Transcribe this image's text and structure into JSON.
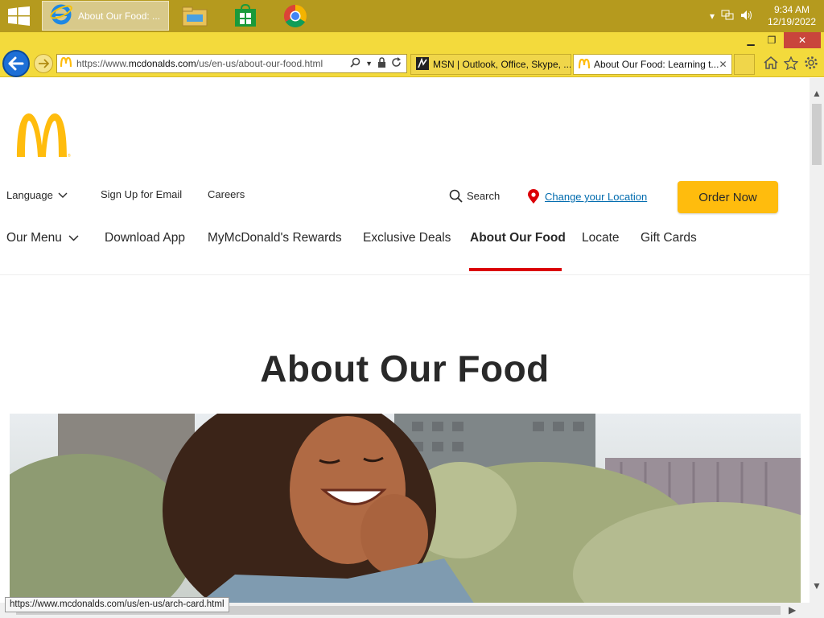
{
  "taskbar": {
    "ie_task_label": "About Our Food: ...",
    "clock_time": "9:34 AM",
    "clock_date": "12/19/2022"
  },
  "browser": {
    "url_prefix": "https://www.",
    "url_domain": "mcdonalds.com",
    "url_path": "/us/en-us/about-our-food.html",
    "tabs": [
      {
        "label": "MSN | Outlook, Office, Skype, ..."
      },
      {
        "label": "About Our Food: Learning t..."
      }
    ],
    "status_url": "https://www.mcdonalds.com/us/en-us/arch-card.html"
  },
  "utility_nav": {
    "language": "Language",
    "signup": "Sign Up for Email",
    "careers": "Careers",
    "search": "Search",
    "change_location": "Change your Location",
    "order_now": "Order Now"
  },
  "main_nav": {
    "items": [
      {
        "label": "Our Menu"
      },
      {
        "label": "Download App"
      },
      {
        "label": "MyMcDonald's Rewards"
      },
      {
        "label": "Exclusive Deals"
      },
      {
        "label": "About Our Food"
      },
      {
        "label": "Locate"
      },
      {
        "label": "Gift Cards"
      }
    ]
  },
  "page": {
    "title": "About Our Food"
  },
  "colors": {
    "brand_yellow": "#ffbc0d",
    "brand_red": "#db0007",
    "link_blue": "#006bae"
  }
}
